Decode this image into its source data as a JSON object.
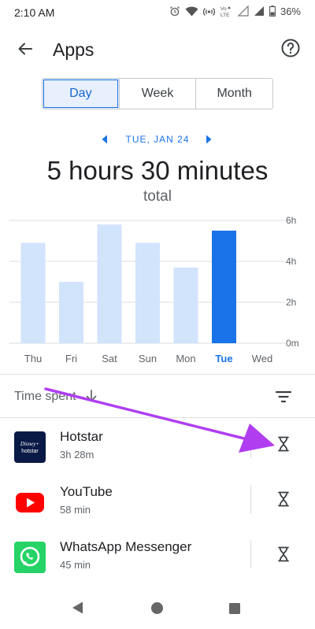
{
  "status_bar": {
    "time": "2:10 AM",
    "battery_percent": "36%",
    "icons": [
      "alarm-icon",
      "wifi-icon",
      "hotspot-icon",
      "volte-icon",
      "no-signal-icon",
      "signal-icon",
      "battery-icon"
    ]
  },
  "app_bar": {
    "title": "Apps",
    "back_icon": "arrow-left-icon",
    "help_icon": "help-circle-icon"
  },
  "period_tabs": [
    {
      "label": "Day",
      "selected": true
    },
    {
      "label": "Week",
      "selected": false
    },
    {
      "label": "Month",
      "selected": false
    }
  ],
  "date_nav": {
    "label": "TUE, JAN 24"
  },
  "summary": {
    "total_time": "5 hours 30 minutes",
    "total_label": "total"
  },
  "chart_data": {
    "type": "bar",
    "categories": [
      "Thu",
      "Fri",
      "Sat",
      "Sun",
      "Mon",
      "Tue",
      "Wed"
    ],
    "values": [
      4.9,
      3.0,
      5.8,
      4.9,
      3.7,
      5.5,
      null
    ],
    "unit": "hours",
    "selected_category": "Tue",
    "ylim": [
      0,
      6
    ],
    "y_ticks": [
      "0m",
      "2h",
      "4h",
      "6h"
    ],
    "y_tick_values": [
      0,
      2,
      4,
      6
    ],
    "grid": true,
    "colors": {
      "bar": "#d2e3fc",
      "bar_selected": "#1a73e8",
      "grid": "#dadce0",
      "label": "#5f6368",
      "label_selected": "#1a73e8"
    }
  },
  "list_header": {
    "label": "Time spent",
    "sort_icon": "arrow-down-icon",
    "filter_icon": "filter-icon"
  },
  "apps": [
    {
      "name": "Hotstar",
      "usage": "3h 28m",
      "icon": "hotstar-icon",
      "icon_text_1": "Disney+",
      "icon_text_2": "hotstar",
      "timer_icon": "hourglass-icon"
    },
    {
      "name": "YouTube",
      "usage": "58 min",
      "icon": "youtube-icon",
      "timer_icon": "hourglass-icon"
    },
    {
      "name": "WhatsApp Messenger",
      "usage": "45 min",
      "icon": "whatsapp-icon",
      "timer_icon": "hourglass-icon"
    }
  ],
  "annotation": {
    "arrow_color": "#b03ef0"
  },
  "nav_bar": {
    "icons": [
      "nav-back-icon",
      "nav-home-icon",
      "nav-recents-icon"
    ]
  }
}
